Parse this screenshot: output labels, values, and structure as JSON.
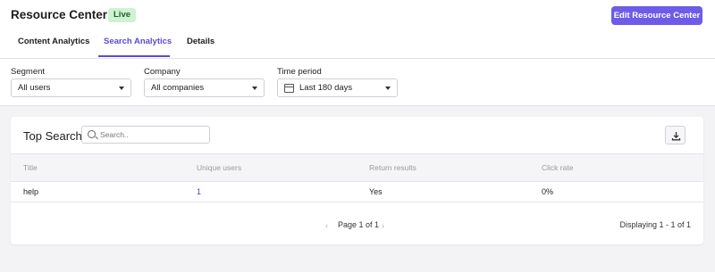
{
  "header": {
    "title": "Resource Center",
    "badge": "Live",
    "edit_button": "Edit Resource Center",
    "tabs": [
      {
        "label": "Content Analytics",
        "active": false
      },
      {
        "label": "Search Analytics",
        "active": true
      },
      {
        "label": "Details",
        "active": false
      }
    ]
  },
  "filters": {
    "segment": {
      "label": "Segment",
      "value": "All users"
    },
    "company": {
      "label": "Company",
      "value": "All companies"
    },
    "period": {
      "label": "Time period",
      "value": "Last 180 days"
    }
  },
  "card": {
    "title": "Top Search",
    "search_placeholder": "Search..",
    "columns": [
      "Title",
      "Unique users",
      "Return results",
      "Click rate"
    ],
    "rows": [
      {
        "title": "help",
        "unique_users": "1",
        "return_results": "Yes",
        "click_rate": "0%"
      }
    ],
    "pagination": {
      "page_text": "Page 1 of 1",
      "prev": "‹",
      "next": "›"
    },
    "displaying": "Displaying 1 - 1 of 1"
  },
  "colors": {
    "accent": "#6c5ce7",
    "badge_bg": "#cdf3d2",
    "link": "#4a3fd0"
  }
}
